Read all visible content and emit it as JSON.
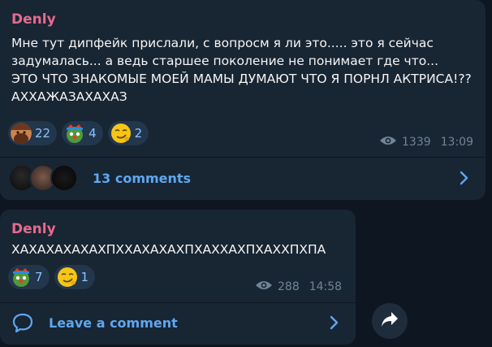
{
  "posts": [
    {
      "author": "Denly",
      "text": "Мне тут дипфейк прислали, с вопросм я ли это.....  это я сейчас задумалась... а ведь старшее поколение не понимает где что...\nЭТО ЧТО ЗНАКОМЫЕ МОЕЙ МАМЫ ДУМАЮТ ЧТО Я ПОРНЛ АКТРИСА!?? АХХАЖАЗАХАХАЗ",
      "reactions": [
        {
          "icon": "bearded-man-emoji",
          "count": "22"
        },
        {
          "icon": "clown-frog-emoji",
          "count": "4"
        },
        {
          "icon": "smirk-face-emoji",
          "count": "2"
        }
      ],
      "views": "1339",
      "time": "13:09",
      "comments_label": "13 comments"
    },
    {
      "author": "Denly",
      "text": "ХАХАХАХАХАХПХХАХАХАХПХАХХАХПХАХХПХПА",
      "reactions": [
        {
          "icon": "clown-frog-emoji",
          "count": "7"
        },
        {
          "icon": "smirk-face-emoji",
          "count": "1"
        }
      ],
      "views": "288",
      "time": "14:58",
      "comments_label": "Leave a comment"
    }
  ],
  "colors": {
    "background": "#0e1621",
    "bubble": "#182533",
    "author": "#e76a8c",
    "link": "#5ea7f0",
    "meta": "#6f8598"
  },
  "icons": {
    "views": "eye-icon",
    "chevron": "chevron-right-icon",
    "comment": "comment-bubble-icon",
    "share": "share-arrow-icon"
  }
}
